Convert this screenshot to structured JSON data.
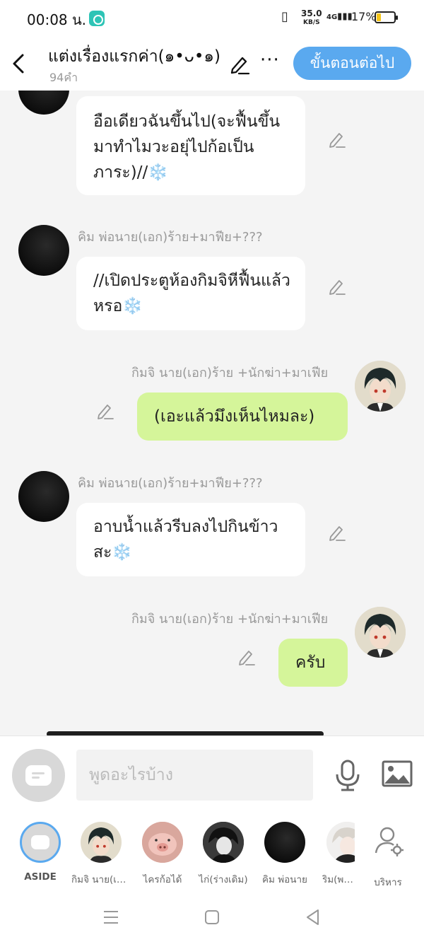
{
  "status": {
    "time": "00:08 น.",
    "speed_value": "35.0",
    "speed_unit": "KB/S",
    "network": "4G",
    "battery": "17%"
  },
  "header": {
    "title": "แต่งเรื่องแรกค่า(๑•ᴗ•๑)",
    "word_count": "94คำ",
    "next_button": "ขั้นตอนต่อไป"
  },
  "chat": {
    "messages": [
      {
        "side": "left",
        "name": "",
        "text": "อือเดียวฉันขึ้นไป(จะฟื้นขึ้นมาทำไมวะอยุ่ไปก้อเป็นภาระ)//❄️"
      },
      {
        "side": "left",
        "name": "คิม พ่อนาย(เอก)ร้าย+มาฟีย+???",
        "text": "//เปิดประตูห้องกิมจิหีฟื้นแล้วหรอ❄️"
      },
      {
        "side": "right",
        "name": "กิมจิ นาย(เอก)ร้าย +นักฆ่า+มาเฟีย",
        "text": "(เอะแล้วมึงเห็นไหมละ)"
      },
      {
        "side": "left",
        "name": "คิม พ่อนาย(เอก)ร้าย+มาฟีย+???",
        "text": "อาบน้ำแล้วรีบลงไปกินข้าวสะ❄️"
      },
      {
        "side": "right",
        "name": "กิมจิ นาย(เอก)ร้าย +นักฆ่า+มาเฟีย",
        "text": "ครับ"
      }
    ]
  },
  "input": {
    "placeholder": "พูดอะไรบ้าง"
  },
  "characters": [
    {
      "label": "ASIDE"
    },
    {
      "label": "กิมจิ นาย(เอก)ร้าย"
    },
    {
      "label": "ไครก้อได้"
    },
    {
      "label": "ไก่(ร่างเดิม)"
    },
    {
      "label": "คิม พ่อนาย"
    },
    {
      "label": "ริม(พระเอก)"
    },
    {
      "label": "บริหาร"
    }
  ],
  "colors": {
    "accent": "#5aa9ef",
    "bubble_green": "#d5f59a",
    "bubble_white": "#ffffff",
    "background": "#f4f4f4"
  },
  "icons": [
    "back-arrow-icon",
    "pencil-icon",
    "more-icon",
    "microphone-icon",
    "image-icon",
    "settings-user-icon",
    "menu-icon",
    "home-icon",
    "back-triangle-icon"
  ]
}
